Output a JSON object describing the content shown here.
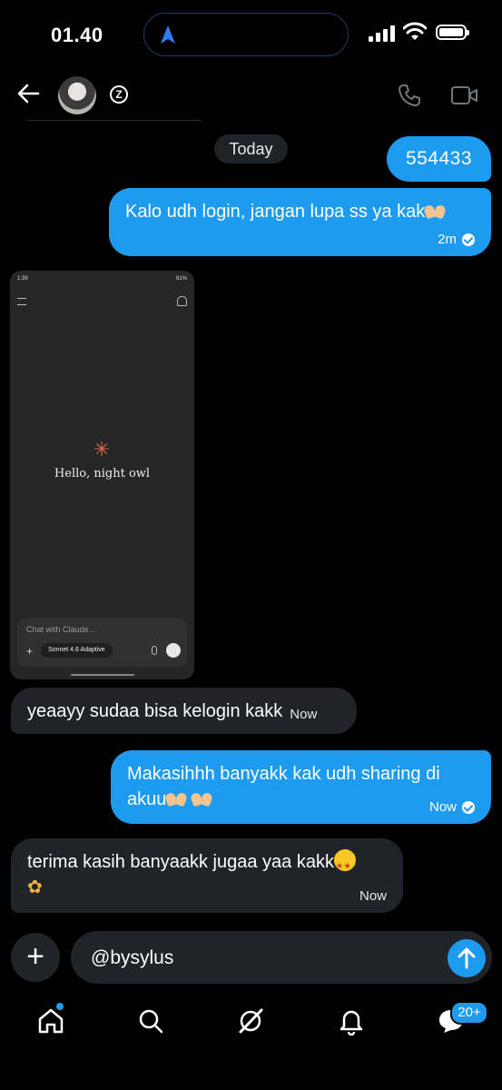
{
  "status_bar": {
    "time": "01.40"
  },
  "header": {
    "contact_avatar": "avatar",
    "badge_glyph": "Z",
    "call_icon": "phone-icon",
    "video_icon": "video-icon"
  },
  "date_divider": "Today",
  "messages": [
    {
      "dir": "out",
      "text": "554433",
      "time": ""
    },
    {
      "dir": "out",
      "text": "Kalo udh login, jangan lupa ss ya kak",
      "time": "2m"
    },
    {
      "dir": "in",
      "type": "image"
    },
    {
      "dir": "in",
      "text": "yeaayy sudaa bisa kelogin kakk",
      "time": "Now"
    },
    {
      "dir": "out",
      "text_line1": "Makasihhh banyakk kak udh sharing di",
      "text_line2": "akuu",
      "time": "Now"
    },
    {
      "dir": "in",
      "text": "terima kasih banyaakk jugaa yaa kakk",
      "time": "Now"
    }
  ],
  "screenshot_image": {
    "status_left": "1:39",
    "status_right": "81%",
    "greeting": "Hello, night owl",
    "input_placeholder": "Chat with Claude...",
    "model_label": "Sonnet 4.6 Adaptive"
  },
  "composer": {
    "value": "@bysylus",
    "add_label": "+"
  },
  "bottom_nav": {
    "items": [
      "home-icon",
      "search-icon",
      "grok-icon",
      "notifications-icon",
      "messages-icon"
    ],
    "messages_badge": "20+"
  },
  "colors": {
    "accent": "#1d9bf0",
    "bubble_in": "#202327",
    "background": "#000000"
  }
}
